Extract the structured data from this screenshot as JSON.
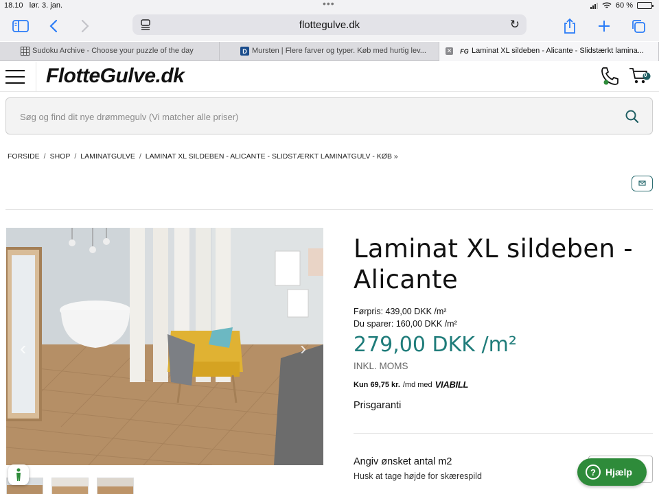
{
  "status_bar": {
    "time": "18.10",
    "date": "lør. 3. jan.",
    "battery": "60 %",
    "battery_level": 0.6
  },
  "browser": {
    "url": "flottegulve.dk",
    "tabs": [
      {
        "title": "Sudoku Archive - Choose your puzzle of the day",
        "favicon": "grid-icon",
        "active": false
      },
      {
        "title": "Mursten | Flere farver og typer. Køb med hurtig lev...",
        "favicon": "D",
        "active": false
      },
      {
        "title": "Laminat XL sildeben - Alicante - Slidstærkt lamina...",
        "favicon": "FG",
        "active": true
      }
    ]
  },
  "site": {
    "logo": "FlotteGulve.dk",
    "cart_count": "0",
    "search_placeholder": "Søg og find dit nye drømmegulv (Vi matcher alle priser)"
  },
  "breadcrumb": [
    "FORSIDE",
    "SHOP",
    "LAMINATGULVE",
    "LAMINAT XL SILDEBEN - ALICANTE - SLIDSTÆRKT LAMINATGULV - KØB »"
  ],
  "product": {
    "title": "Laminat XL sildeben - Alicante",
    "before_price": "Førpris: 439,00 DKK /m²",
    "saving": "Du sparer: 160,00 DKK /m²",
    "price": "279,00 DKK /m²",
    "vat": "INKL. MOMS",
    "installment": "Kun 69,75 kr.",
    "installment_suffix": "/md med",
    "installment_brand": "VIABILL",
    "guarantee": "Prisgaranti",
    "qty_label": "Angiv ønsket antal m2",
    "qty_hint": "Husk at tage højde for skærespild"
  },
  "help_button": "Hjælp",
  "colors": {
    "accent": "#1f7c7a",
    "help": "#2e8b3a",
    "browser_blue": "#2a7cf7"
  }
}
